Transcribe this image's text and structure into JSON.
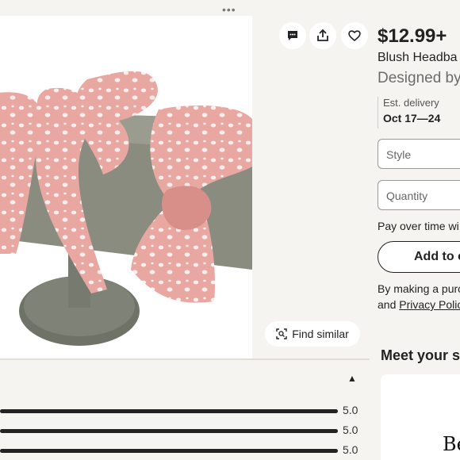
{
  "window": {
    "more_dots": "•••"
  },
  "actions": {
    "icons": [
      "message-icon",
      "share-icon",
      "heart-icon"
    ],
    "find_similar_label": "Find similar"
  },
  "product": {
    "price": "$12.99+",
    "title": "Blush Headba",
    "designer": "Designed by",
    "delivery_label": "Est. delivery",
    "delivery_date": "Oct 17—24",
    "style_placeholder": "Style",
    "quantity_placeholder": "Quantity",
    "pay_over_time": "Pay over time wi",
    "add_to_cart": "Add to c",
    "legal_line1": "By making a purc",
    "legal_and": "and ",
    "legal_link": "Privacy Polic"
  },
  "seller": {
    "heading": "Meet your se",
    "logo_text": "Be"
  },
  "reviews": {
    "ratings": [
      {
        "label": "5.0",
        "fraction": 1.0
      },
      {
        "label": "5.0",
        "fraction": 1.0
      },
      {
        "label": "5.0",
        "fraction": 1.0
      }
    ]
  },
  "colors": {
    "background": "#f6f4f0",
    "headband_pink": "#e9a7a2",
    "dots": "#fbeeee",
    "stand_gray": "#7c7f72"
  }
}
